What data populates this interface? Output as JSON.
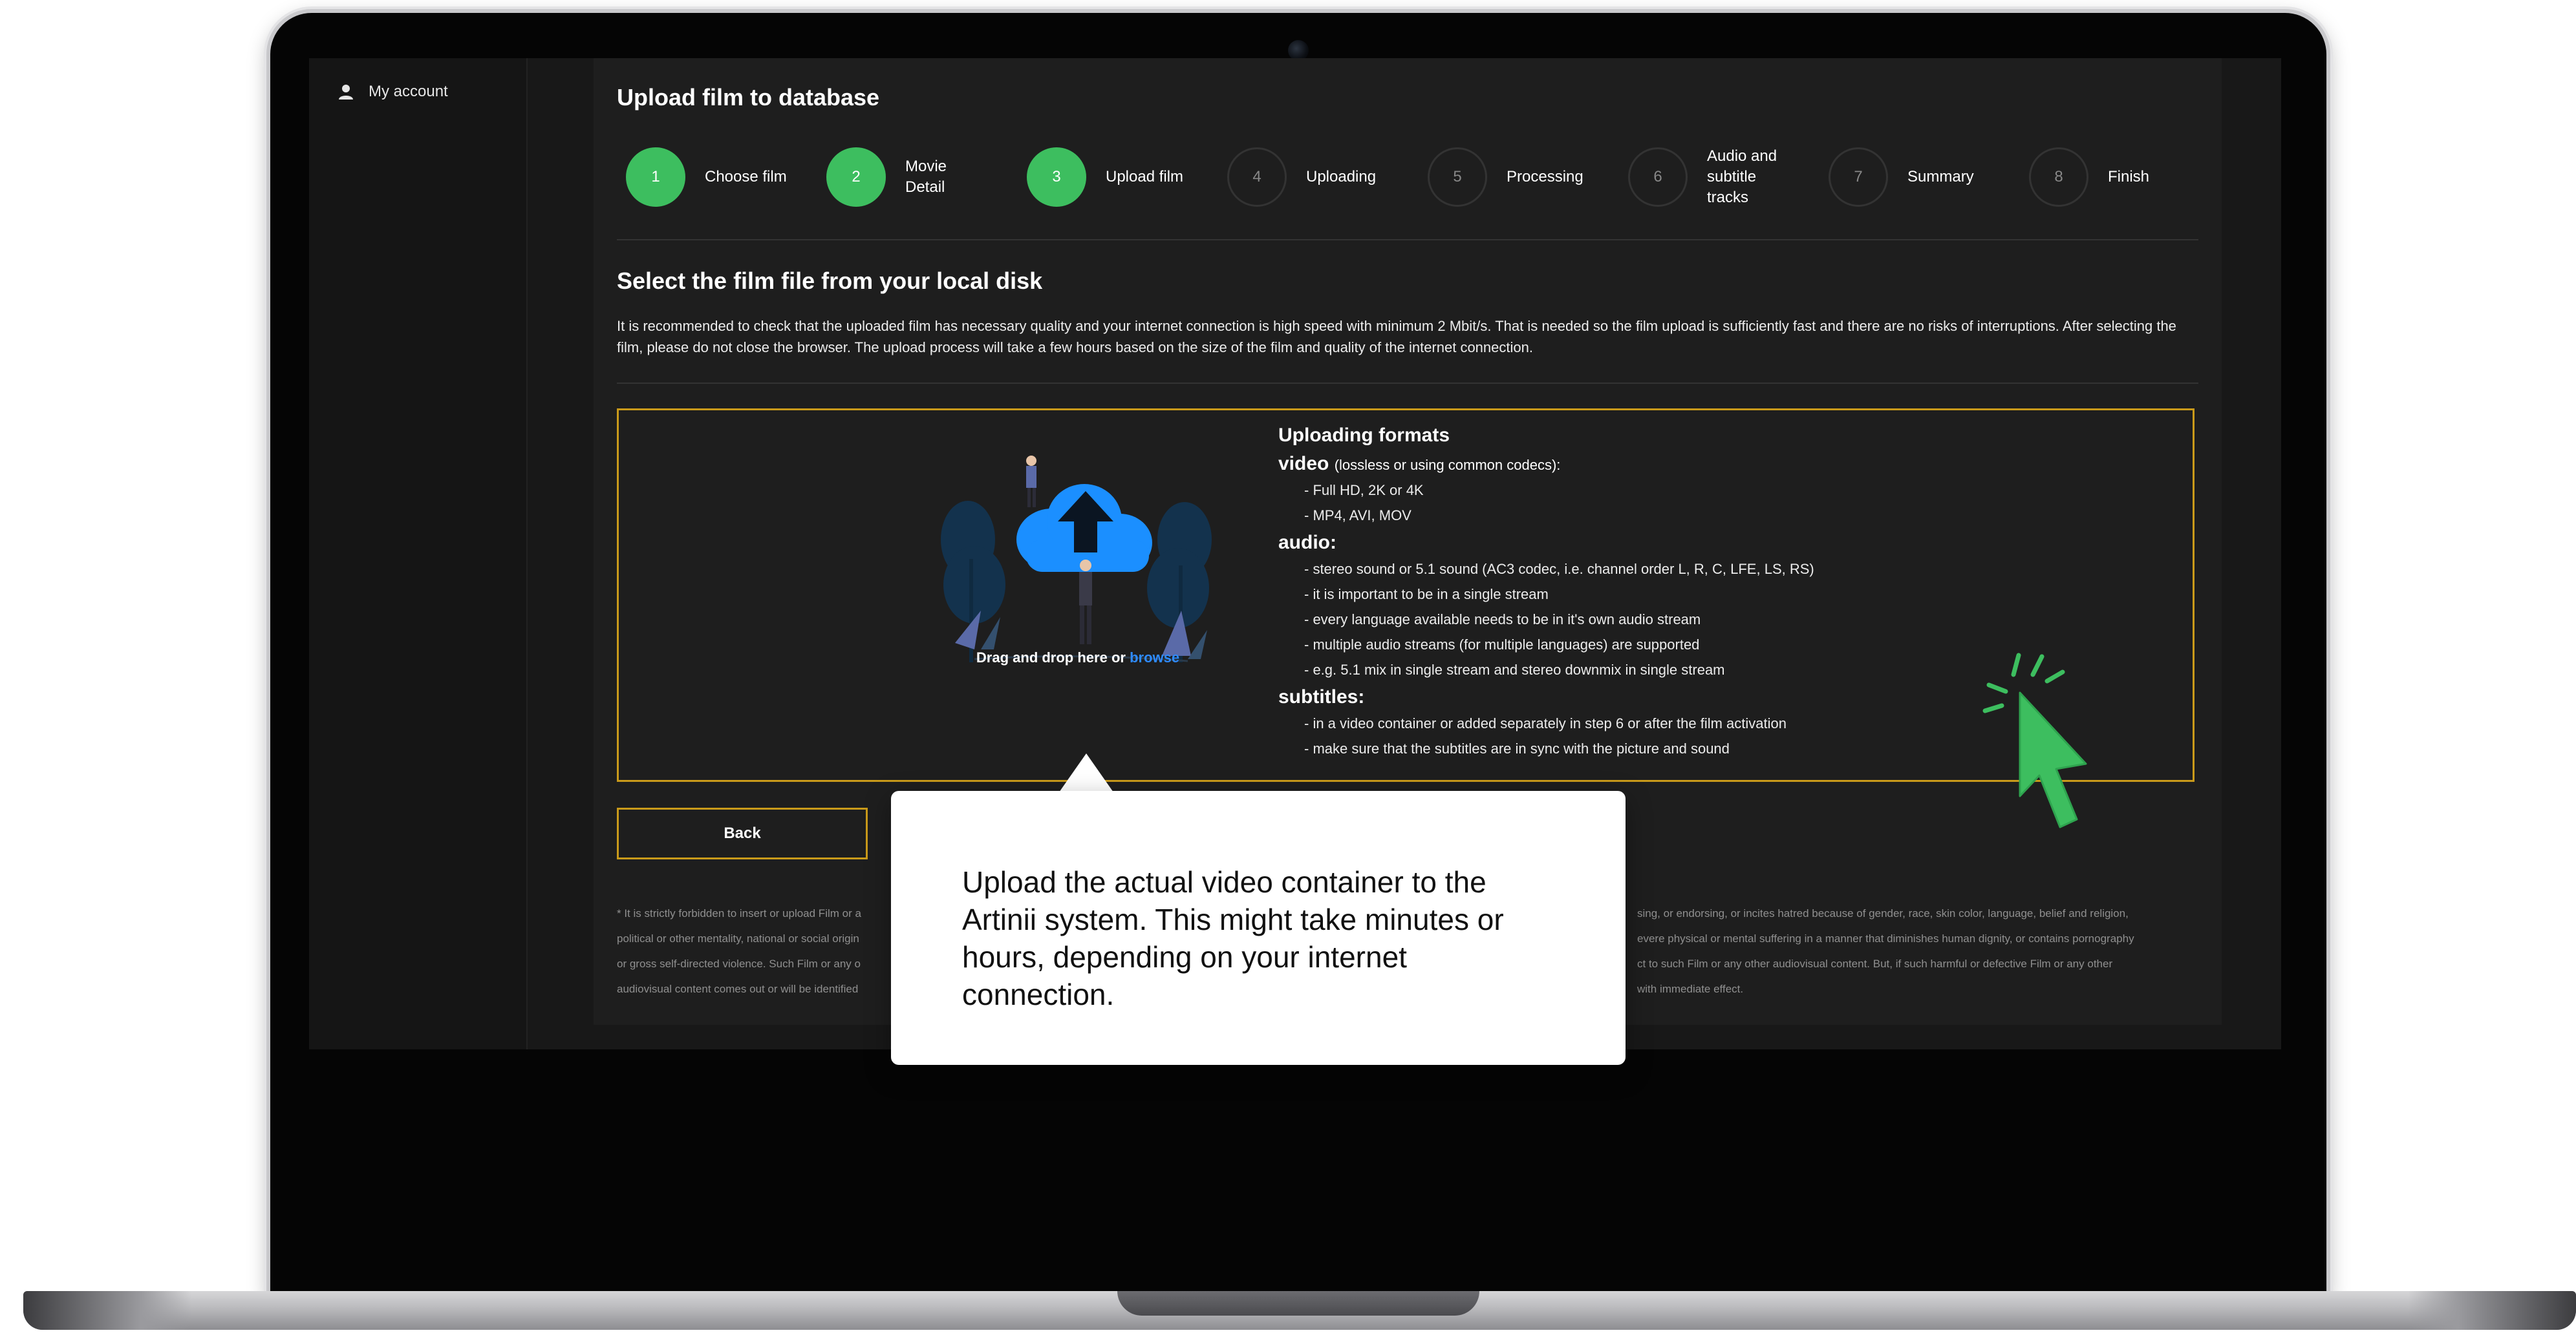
{
  "account": {
    "label": "My account",
    "icon": "user-icon"
  },
  "page": {
    "title": "Upload film to database"
  },
  "steps": [
    {
      "number": "1",
      "label": "Choose film",
      "state": "done"
    },
    {
      "number": "2",
      "label": "Movie Detail",
      "state": "done"
    },
    {
      "number": "3",
      "label": "Upload film",
      "state": "done"
    },
    {
      "number": "4",
      "label": "Uploading",
      "state": "todo"
    },
    {
      "number": "5",
      "label": "Processing",
      "state": "todo"
    },
    {
      "number": "6",
      "label": "Audio and subtitle tracks",
      "state": "todo"
    },
    {
      "number": "7",
      "label": "Summary",
      "state": "todo"
    },
    {
      "number": "8",
      "label": "Finish",
      "state": "todo"
    }
  ],
  "section": {
    "title": "Select the film file from your local disk",
    "description": "It is recommended to check that the uploaded film has necessary quality and your internet connection is high speed with minimum 2 Mbit/s. That is needed so the film upload is sufficiently fast and there are no risks of interruptions. After selecting the film, please do not close the browser. The upload process will take a few hours based on the size of the film and quality of the internet connection."
  },
  "dropzone": {
    "text": "Drag and drop here or ",
    "link": "browse",
    "illustration": "cloud-upload-illustration"
  },
  "formats": {
    "title": "Uploading formats",
    "video": {
      "heading": "video",
      "note": "(lossless or using common codecs):",
      "items": [
        "- Full HD, 2K or 4K",
        "- MP4, AVI, MOV"
      ]
    },
    "audio": {
      "heading": "audio:",
      "items": [
        "- stereo sound or 5.1 sound (AC3 codec, i.e. channel order L, R, C, LFE, LS, RS)",
        "- it is important to be in a single stream",
        "- every language available needs to be in it's own audio stream",
        "- multiple audio streams (for multiple languages) are supported",
        "- e.g. 5.1 mix in single stream and stereo downmix in single stream"
      ]
    },
    "subtitles": {
      "heading": "subtitles:",
      "items": [
        "- in a video container or added separately in step 6 or after the film activation",
        "- make sure that the subtitles are in sync with the picture and sound"
      ]
    }
  },
  "buttons": {
    "back": "Back"
  },
  "legal": {
    "lines": [
      {
        "left": "* It is strictly forbidden to insert or upload Film or a",
        "right": "sing, or endorsing, or incites hatred because of gender, race, skin color, language, belief and religion,"
      },
      {
        "left": "political or other mentality, national or social origin",
        "right": "evere physical or mental suffering in a manner that diminishes human dignity, or contains pornography"
      },
      {
        "left": "or gross self-directed violence. Such Film or any o",
        "right": "ct to such Film or any other audiovisual content. But, if such harmful or defective Film or any other"
      },
      {
        "left": "audiovisual content comes out or will be identified",
        "right": "with immediate effect."
      }
    ]
  },
  "tooltip": {
    "text": "Upload the actual video container to the Artinii system. This might take minutes or hours, depending on your internet connection."
  },
  "colors": {
    "accent_green": "#3dbe5f",
    "gold_border": "#c99a1a",
    "link_blue": "#2e8bff",
    "screen_bg": "#1e1e1e"
  },
  "cursor": {
    "icon": "click-cursor-icon"
  }
}
